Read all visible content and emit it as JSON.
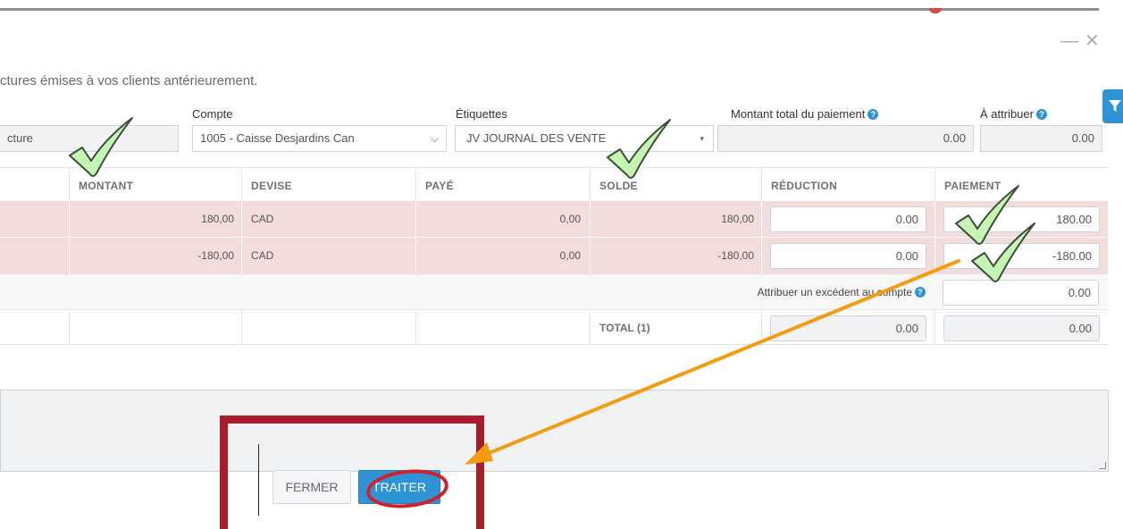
{
  "window": {
    "minimize_icon": "minimize-icon",
    "close_icon": "close-icon"
  },
  "subtitle": "ctures émises à vos clients antérieurement.",
  "form": {
    "reference_value": "cture",
    "account_label": "Compte",
    "account_value": "1005 - Caisse Desjardins Can",
    "tags_label": "Étiquettes",
    "tags_value": "JV JOURNAL DES VENTE",
    "total_label": "Montant total du paiement",
    "total_value": "0.00",
    "assign_label": "À attribuer",
    "assign_value": "0.00",
    "help_glyph": "?"
  },
  "table": {
    "headers": [
      "MONTANT",
      "DEVISE",
      "PAYÉ",
      "SOLDE",
      "RÉDUCTION",
      "PAIEMENT"
    ],
    "rows": [
      {
        "montant": "180,00",
        "devise": "CAD",
        "paye": "0,00",
        "solde": "180,00",
        "reduction": "0.00",
        "paiement": "180.00"
      },
      {
        "montant": "-180,00",
        "devise": "CAD",
        "paye": "0,00",
        "solde": "-180,00",
        "reduction": "0.00",
        "paiement": "-180.00"
      }
    ],
    "excess_label": "Attribuer un excédent au compte",
    "excess_value": "0.00",
    "total_label": "TOTAL (1)",
    "total_reduction": "0.00",
    "total_payment": "0.00"
  },
  "buttons": {
    "close": "FERMER",
    "process": "TRAITER"
  },
  "colors": {
    "accent": "#2f94d6",
    "row_highlight": "#f2dcdc",
    "annotation_red": "#a91d2b",
    "arrow_orange": "#f39c12",
    "checkmark_green": "#b8f0a8"
  }
}
